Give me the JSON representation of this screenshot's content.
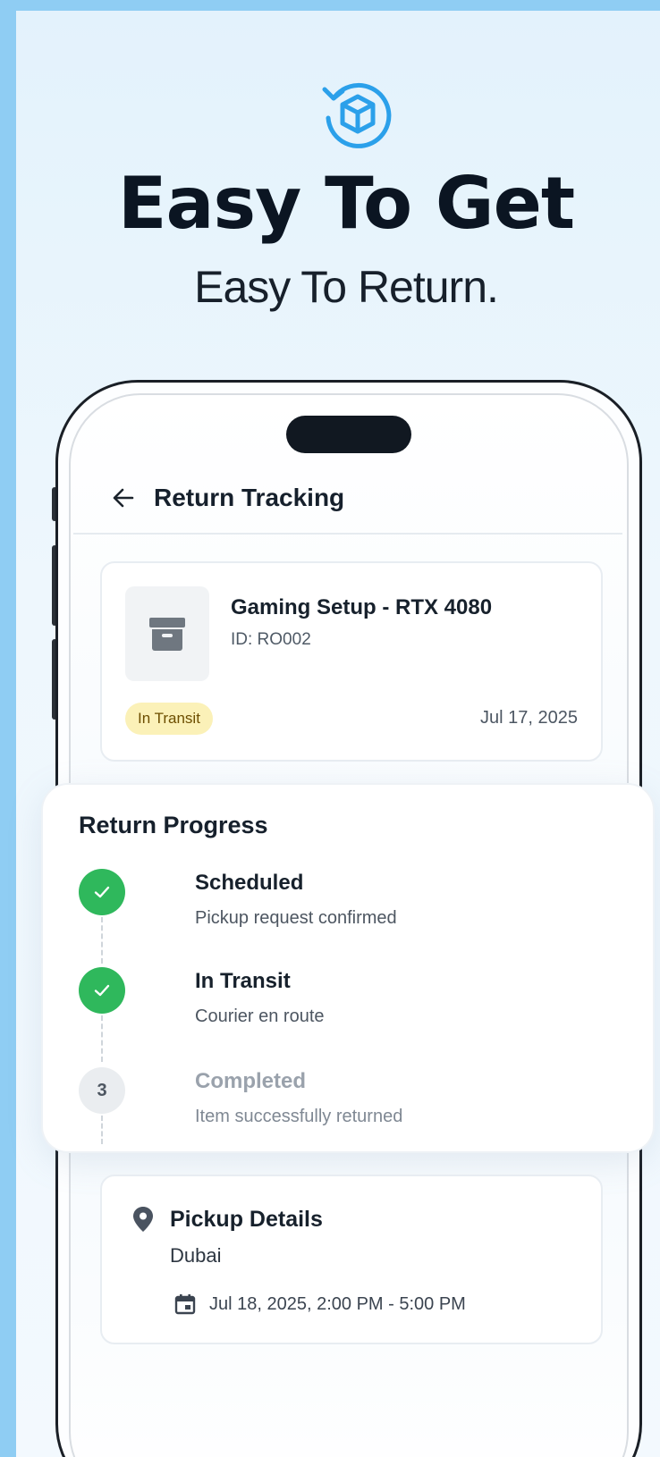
{
  "hero": {
    "icon": "box-return-icon",
    "title": "Easy To Get",
    "subtitle": "Easy To Return."
  },
  "header": {
    "back_icon": "arrow-left-icon",
    "title": "Return Tracking"
  },
  "item": {
    "icon": "archive-box-icon",
    "name": "Gaming Setup - RTX 4080",
    "id": "ID: RO002",
    "status": "In Transit",
    "date": "Jul 17, 2025"
  },
  "progress": {
    "title": "Return Progress",
    "steps": [
      {
        "title": "Scheduled",
        "desc": "Pickup request confirmed",
        "state": "done",
        "icon": "check-icon"
      },
      {
        "title": "In Transit",
        "desc": "Courier en route",
        "state": "done",
        "icon": "check-icon"
      },
      {
        "title": "Completed",
        "desc": "Item successfully returned",
        "state": "pending",
        "number": "3"
      }
    ]
  },
  "pickup": {
    "icon": "location-pin-icon",
    "title": "Pickup Details",
    "city": "Dubai",
    "calendar_icon": "calendar-icon",
    "window": "Jul 18, 2025, 2:00 PM - 5:00 PM"
  },
  "colors": {
    "accent": "#2ba0ea",
    "success": "#2fb85c",
    "badge_bg": "#fbf1b8",
    "background": "#8fcdf3"
  }
}
